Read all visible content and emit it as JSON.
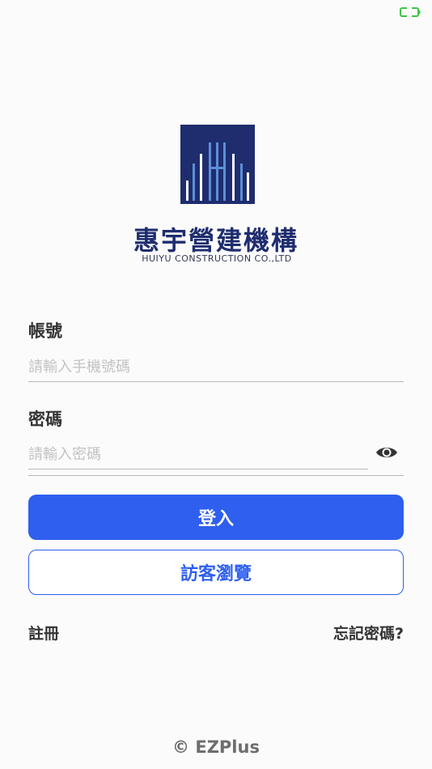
{
  "brand": {
    "name_zh": "惠宇營建機構",
    "name_en": "HUIYU CONSTRUCTION CO.,LTD"
  },
  "account": {
    "label": "帳號",
    "placeholder": "請輸入手機號碼"
  },
  "password": {
    "label": "密碼",
    "placeholder": "請輸入密碼"
  },
  "actions": {
    "login_label": "登入",
    "guest_label": "訪客瀏覽",
    "register_label": "註冊",
    "forgot_label": "忘記密碼?"
  },
  "footer": {
    "copyright": "© EZPlus"
  },
  "colors": {
    "primary": "#2f5fef",
    "logo_bg": "#1f2d6e",
    "battery": "#3fc24a"
  }
}
